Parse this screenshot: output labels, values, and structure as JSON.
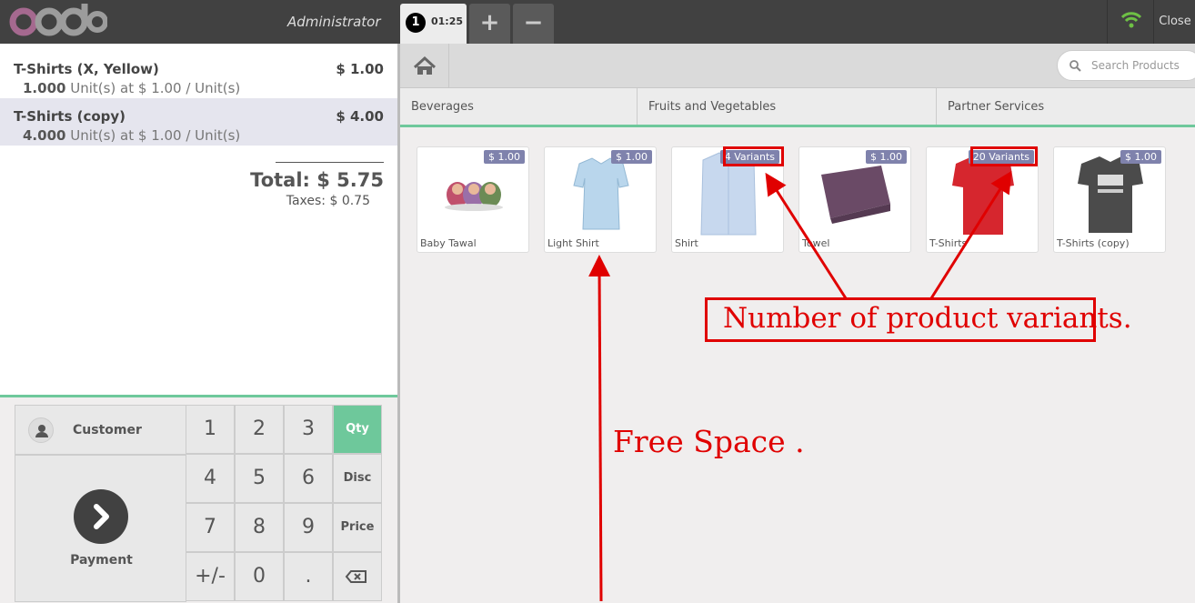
{
  "topbar": {
    "logo_text": "odoo",
    "user": "Administrator",
    "order_tab": {
      "number": "1",
      "time": "01:25"
    },
    "add_order_label": "+",
    "remove_order_label": "−",
    "close_label": "Close"
  },
  "orderlines": [
    {
      "name": "T-Shirts (X, Yellow)",
      "price": "$ 1.00",
      "qty": "1.000",
      "unit_info": " Unit(s) at $ 1.00 / Unit(s)"
    },
    {
      "name": "T-Shirts (copy)",
      "price": "$ 4.00",
      "qty": "4.000",
      "unit_info": " Unit(s) at $ 1.00 / Unit(s)"
    }
  ],
  "summary": {
    "total": "Total: $ 5.75",
    "taxes": "Taxes: $ 0.75"
  },
  "actionpad": {
    "customer": "Customer",
    "payment": "Payment"
  },
  "numpad": {
    "keys": [
      "1",
      "2",
      "3",
      "4",
      "5",
      "6",
      "7",
      "8",
      "9",
      "+/-",
      "0",
      "."
    ],
    "modes": [
      "Qty",
      "Disc",
      "Price"
    ],
    "active_mode": "Qty",
    "accent": "#6ec89b"
  },
  "search": {
    "placeholder": "Search Products"
  },
  "categories": [
    "Beverages",
    "Fruits and Vegetables",
    "Partner Services"
  ],
  "products": [
    {
      "name": "Baby Tawal",
      "tag": "$ 1.00"
    },
    {
      "name": "Light Shirt",
      "tag": "$ 1.00"
    },
    {
      "name": "Shirt",
      "tag": "4 Variants"
    },
    {
      "name": "Towel",
      "tag": "$ 1.00"
    },
    {
      "name": "T-Shirts",
      "tag": "20 Variants"
    },
    {
      "name": "T-Shirts (copy)",
      "tag": "$ 1.00"
    }
  ],
  "annotations": {
    "variants_note": "Number of product variants.",
    "free_space_note": "Free Space .",
    "color": "#e00000"
  }
}
